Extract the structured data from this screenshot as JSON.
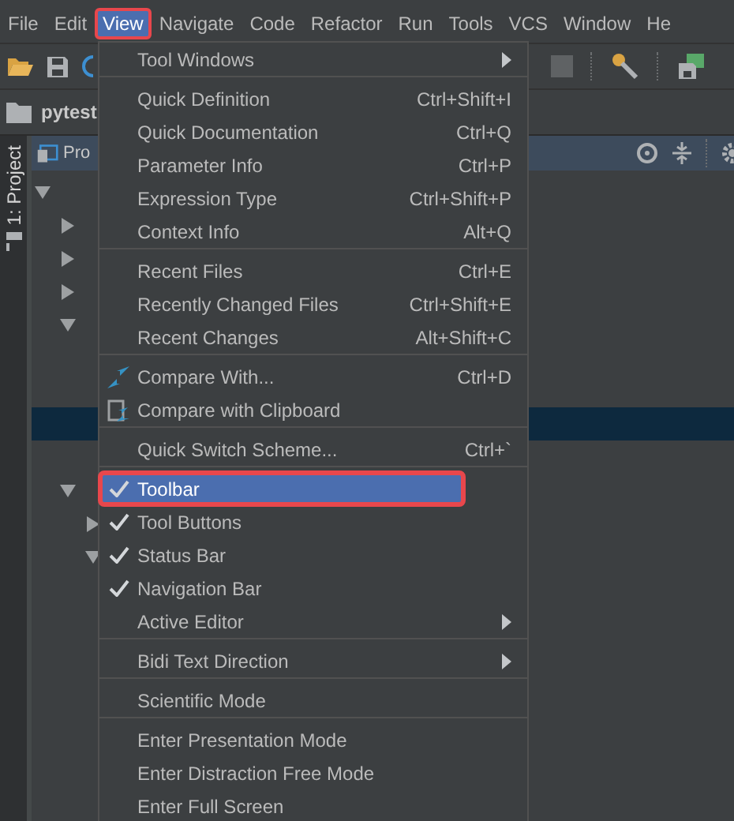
{
  "menubar": [
    {
      "label": "File",
      "selected": false,
      "highlighted": false
    },
    {
      "label": "Edit",
      "selected": false,
      "highlighted": false
    },
    {
      "label": "View",
      "selected": true,
      "highlighted": true
    },
    {
      "label": "Navigate",
      "selected": false,
      "highlighted": false
    },
    {
      "label": "Code",
      "selected": false,
      "highlighted": false
    },
    {
      "label": "Refactor",
      "selected": false,
      "highlighted": false
    },
    {
      "label": "Run",
      "selected": false,
      "highlighted": false
    },
    {
      "label": "Tools",
      "selected": false,
      "highlighted": false
    },
    {
      "label": "VCS",
      "selected": false,
      "highlighted": false
    },
    {
      "label": "Window",
      "selected": false,
      "highlighted": false
    },
    {
      "label": "He",
      "selected": false,
      "highlighted": false
    }
  ],
  "navigation_bar": {
    "project": "pytest"
  },
  "side_tab": {
    "label": "1: Project"
  },
  "project_panel": {
    "title": "Pro",
    "tree": [
      {
        "kind": "folder",
        "expanded": true,
        "selected": false,
        "children": [
          {
            "kind": "folder",
            "expanded": false,
            "selected": false
          },
          {
            "kind": "folder",
            "expanded": false,
            "selected": false
          },
          {
            "kind": "folder",
            "expanded": false,
            "selected": false
          },
          {
            "kind": "folder",
            "expanded": true,
            "selected": false,
            "children": [
              {
                "kind": "file",
                "selected": false
              },
              {
                "kind": "file",
                "selected": false
              },
              {
                "kind": "file",
                "selected": true
              },
              {
                "kind": "file",
                "selected": false
              }
            ]
          },
          {
            "kind": "folder",
            "expanded": true,
            "selected": false,
            "children": [
              {
                "kind": "folder",
                "expanded": false,
                "selected": false
              },
              {
                "kind": "folder",
                "expanded": true,
                "selected": false
              }
            ]
          }
        ]
      }
    ]
  },
  "view_menu": [
    {
      "kind": "item",
      "label": "Tool Windows",
      "submenu": true,
      "checked": false,
      "selected": false,
      "highlighted": false
    },
    {
      "kind": "separator"
    },
    {
      "kind": "item",
      "label": "Quick Definition",
      "shortcut": "Ctrl+Shift+I",
      "submenu": false,
      "checked": false,
      "selected": false,
      "highlighted": false
    },
    {
      "kind": "item",
      "label": "Quick Documentation",
      "shortcut": "Ctrl+Q",
      "submenu": false,
      "checked": false,
      "selected": false,
      "highlighted": false
    },
    {
      "kind": "item",
      "label": "Parameter Info",
      "shortcut": "Ctrl+P",
      "submenu": false,
      "checked": false,
      "selected": false,
      "highlighted": false
    },
    {
      "kind": "item",
      "label": "Expression Type",
      "shortcut": "Ctrl+Shift+P",
      "submenu": false,
      "checked": false,
      "selected": false,
      "highlighted": false
    },
    {
      "kind": "item",
      "label": "Context Info",
      "shortcut": "Alt+Q",
      "submenu": false,
      "checked": false,
      "selected": false,
      "highlighted": false
    },
    {
      "kind": "separator"
    },
    {
      "kind": "item",
      "label": "Recent Files",
      "shortcut": "Ctrl+E",
      "submenu": false,
      "checked": false,
      "selected": false,
      "highlighted": false
    },
    {
      "kind": "item",
      "label": "Recently Changed Files",
      "shortcut": "Ctrl+Shift+E",
      "submenu": false,
      "checked": false,
      "selected": false,
      "highlighted": false
    },
    {
      "kind": "item",
      "label": "Recent Changes",
      "shortcut": "Alt+Shift+C",
      "submenu": false,
      "checked": false,
      "selected": false,
      "highlighted": false
    },
    {
      "kind": "separator"
    },
    {
      "kind": "compare",
      "label": "Compare With...",
      "shortcut": "Ctrl+D",
      "submenu": false,
      "checked": false,
      "selected": false,
      "highlighted": false
    },
    {
      "kind": "clipboard",
      "label": "Compare with Clipboard",
      "submenu": false,
      "checked": false,
      "selected": false,
      "highlighted": false
    },
    {
      "kind": "separator"
    },
    {
      "kind": "item",
      "label": "Quick Switch Scheme...",
      "shortcut": "Ctrl+`",
      "submenu": false,
      "checked": false,
      "selected": false,
      "highlighted": false
    },
    {
      "kind": "separator"
    },
    {
      "kind": "item",
      "label": "Toolbar",
      "submenu": false,
      "checked": true,
      "selected": true,
      "highlighted": true
    },
    {
      "kind": "item",
      "label": "Tool Buttons",
      "submenu": false,
      "checked": true,
      "selected": false,
      "highlighted": false
    },
    {
      "kind": "item",
      "label": "Status Bar",
      "submenu": false,
      "checked": true,
      "selected": false,
      "highlighted": false
    },
    {
      "kind": "item",
      "label": "Navigation Bar",
      "submenu": false,
      "checked": true,
      "selected": false,
      "highlighted": false
    },
    {
      "kind": "item",
      "label": "Active Editor",
      "submenu": true,
      "checked": false,
      "selected": false,
      "highlighted": false
    },
    {
      "kind": "separator"
    },
    {
      "kind": "item",
      "label": "Bidi Text Direction",
      "submenu": true,
      "checked": false,
      "selected": false,
      "highlighted": false
    },
    {
      "kind": "separator"
    },
    {
      "kind": "item",
      "label": "Scientific Mode",
      "submenu": false,
      "checked": false,
      "selected": false,
      "highlighted": false
    },
    {
      "kind": "separator"
    },
    {
      "kind": "item",
      "label": "Enter Presentation Mode",
      "submenu": false,
      "checked": false,
      "selected": false,
      "highlighted": false
    },
    {
      "kind": "item",
      "label": "Enter Distraction Free Mode",
      "submenu": false,
      "checked": false,
      "selected": false,
      "highlighted": false
    },
    {
      "kind": "item",
      "label": "Enter Full Screen",
      "submenu": false,
      "checked": false,
      "selected": false,
      "highlighted": false
    }
  ]
}
